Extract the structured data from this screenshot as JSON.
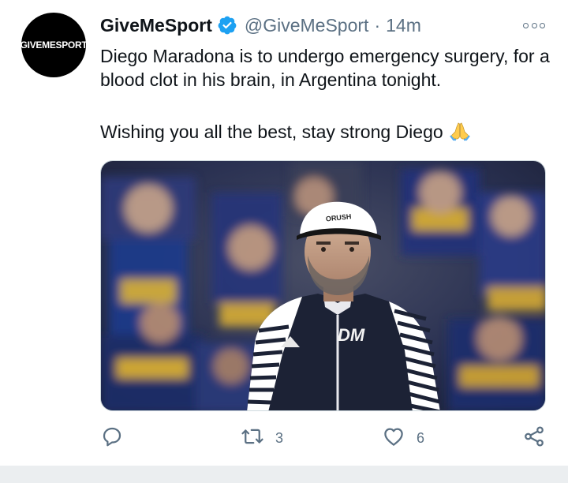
{
  "account": {
    "avatar_text": "GIVEMESPORT",
    "display_name": "GiveMeSport",
    "handle": "@GiveMeSport",
    "separator": "·",
    "time": "14m",
    "verified": true
  },
  "tweet": {
    "line1": "Diego Maradona is to undergo emergency surgery, for a blood clot in his brain, in Argentina tonight.",
    "line2": "Wishing you all the best, stay strong Diego",
    "emoji_icon": "folded-hands-icon"
  },
  "media": {
    "description_icon": "photo",
    "jacket_logo": "DM"
  },
  "actions": {
    "reply_count": "",
    "retweet_count": "3",
    "like_count": "6"
  },
  "colors": {
    "verified_blue": "#1da1f2",
    "secondary_text": "#5b7083",
    "primary_text": "#0f1419"
  }
}
